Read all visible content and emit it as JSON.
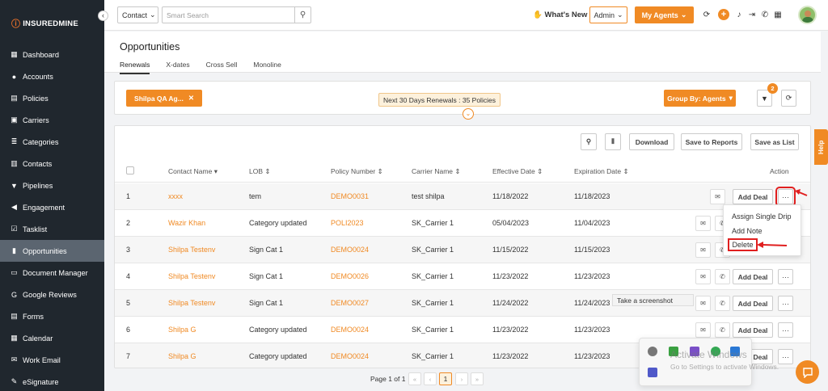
{
  "sidebar": {
    "brand": "INSUREDMINE",
    "collapse_icon": "chevron-left-icon",
    "items": [
      {
        "label": "Dashboard",
        "icon": "dashboard-icon"
      },
      {
        "label": "Accounts",
        "icon": "users-icon"
      },
      {
        "label": "Policies",
        "icon": "document-icon"
      },
      {
        "label": "Carriers",
        "icon": "briefcase-icon"
      },
      {
        "label": "Categories",
        "icon": "layers-icon"
      },
      {
        "label": "Contacts",
        "icon": "contact-card-icon"
      },
      {
        "label": "Pipelines",
        "icon": "funnel-icon"
      },
      {
        "label": "Engagement",
        "icon": "megaphone-icon"
      },
      {
        "label": "Tasklist",
        "icon": "checklist-icon"
      },
      {
        "label": "Opportunities",
        "icon": "bar-chart-icon",
        "active": true
      },
      {
        "label": "Document Manager",
        "icon": "file-icon"
      },
      {
        "label": "Google Reviews",
        "icon": "google-icon"
      },
      {
        "label": "Forms",
        "icon": "form-icon"
      },
      {
        "label": "Calendar",
        "icon": "calendar-icon"
      },
      {
        "label": "Work Email",
        "icon": "mail-icon"
      },
      {
        "label": "eSignature",
        "icon": "signature-icon"
      }
    ]
  },
  "topbar": {
    "contact_select": "Contact",
    "search_placeholder": "Smart Search",
    "whats_new": "What's New",
    "admin_select": "Admin",
    "my_agents": "My Agents"
  },
  "page": {
    "title": "Opportunities",
    "tabs": [
      "Renewals",
      "X-dates",
      "Cross Sell",
      "Monoline"
    ],
    "active_tab": "Renewals"
  },
  "filters": {
    "agent_chip": "Shilpa QA Ag...",
    "renewals_summary": "Next 30 Days Renewals : 35 Policies",
    "group_by": "Group By: Agents",
    "filter_count": "2"
  },
  "toolbar": {
    "download": "Download",
    "save_to_reports": "Save to Reports",
    "save_as_list": "Save as List"
  },
  "table": {
    "columns": {
      "contact_name": "Contact Name",
      "lob": "LOB",
      "policy_number": "Policy Number",
      "carrier_name": "Carrier Name",
      "effective_date": "Effective Date",
      "expiration_date": "Expiration Date",
      "action": "Action"
    },
    "add_deal_label": "Add Deal",
    "more_label": "···",
    "rows": [
      {
        "num": "1",
        "contact": "xxxx",
        "lob": "tem",
        "policy": "DEMO0031",
        "carrier": "test shilpa",
        "effective": "11/18/2022",
        "expiration": "11/18/2023"
      },
      {
        "num": "2",
        "contact": "Wazir Khan",
        "lob": "Category updated",
        "policy": "POLI2023",
        "carrier": "SK_Carrier 1",
        "effective": "05/04/2023",
        "expiration": "11/04/2023"
      },
      {
        "num": "3",
        "contact": "Shilpa Testenv",
        "lob": "Sign Cat 1",
        "policy": "DEMO0024",
        "carrier": "SK_Carrier 1",
        "effective": "11/15/2022",
        "expiration": "11/15/2023"
      },
      {
        "num": "4",
        "contact": "Shilpa Testenv",
        "lob": "Sign Cat 1",
        "policy": "DEMO0026",
        "carrier": "SK_Carrier 1",
        "effective": "11/23/2022",
        "expiration": "11/23/2023"
      },
      {
        "num": "5",
        "contact": "Shilpa Testenv",
        "lob": "Sign Cat 1",
        "policy": "DEMO0027",
        "carrier": "SK_Carrier 1",
        "effective": "11/24/2022",
        "expiration": "11/24/2023"
      },
      {
        "num": "6",
        "contact": "Shilpa G",
        "lob": "Category updated",
        "policy": "DEMO0024",
        "carrier": "SK_Carrier 1",
        "effective": "11/23/2022",
        "expiration": "11/23/2023"
      },
      {
        "num": "7",
        "contact": "Shilpa G",
        "lob": "Category updated",
        "policy": "DEMO0024",
        "carrier": "SK_Carrier 1",
        "effective": "11/23/2022",
        "expiration": "11/23/2023"
      }
    ]
  },
  "action_menu": {
    "items": [
      "Assign Single Drip",
      "Add Note",
      "Delete"
    ]
  },
  "tooltip": "Take a screenshot",
  "pagination": {
    "label": "Page 1 of 1",
    "first": "«",
    "prev": "‹",
    "current": "1",
    "next": "›",
    "last": "»"
  },
  "help_tab": "Help",
  "windows": {
    "activate_title": "Activate Windows",
    "activate_sub": "Go to Settings to activate Windows."
  },
  "colors": {
    "accent": "#f08a24",
    "sidebar_bg": "#20272e",
    "sidebar_active": "#5b6570",
    "link": "#f08a24",
    "annotation_red": "#e01f1f"
  }
}
